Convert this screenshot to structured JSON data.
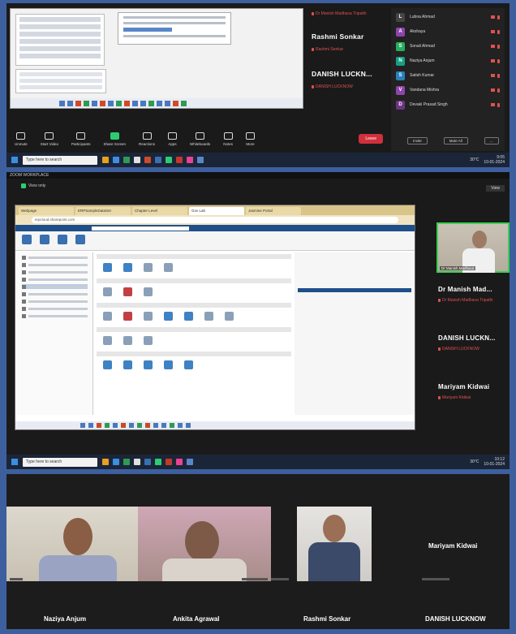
{
  "panel1": {
    "tile_names": [
      {
        "big": "",
        "small": "Dr Manish Madhava Tripathi"
      },
      {
        "big": "Rashmi Sonkar",
        "small": "Rashmi Sonkar"
      },
      {
        "big": "DANISH LUCKN...",
        "small": "DANISH LUCKNOW"
      }
    ],
    "participants": [
      {
        "name": "Lubna Ahmad",
        "initial": "L",
        "color": "#444444"
      },
      {
        "name": "Akshaya",
        "initial": "A",
        "color": "#8e44ad"
      },
      {
        "name": "Sonali Ahmad",
        "initial": "S",
        "color": "#27ae60"
      },
      {
        "name": "Naziya Anjum",
        "initial": "N",
        "color": "#16a085"
      },
      {
        "name": "Satish Kumar",
        "initial": "S",
        "color": "#2980b9"
      },
      {
        "name": "Vandana Mishra",
        "initial": "V",
        "color": "#8e44ad"
      },
      {
        "name": "Devaki Prasad Singh",
        "initial": "D",
        "color": "#6c3483"
      }
    ],
    "panel_buttons": [
      "Invite",
      "Mute All",
      "..."
    ],
    "toolbar": [
      {
        "label": "Unmute",
        "icon": "mic-icon",
        "green": false
      },
      {
        "label": "Start Video",
        "icon": "video-icon",
        "green": false
      },
      {
        "label": "Participants",
        "icon": "participants-icon",
        "green": false
      },
      {
        "label": "Share Screen",
        "icon": "share-screen-icon",
        "green": true
      },
      {
        "label": "Reactions",
        "icon": "reactions-icon",
        "green": false
      },
      {
        "label": "Apps",
        "icon": "apps-icon",
        "green": false
      },
      {
        "label": "Whiteboards",
        "icon": "whiteboard-icon",
        "green": false
      },
      {
        "label": "Notes",
        "icon": "notes-icon",
        "green": false
      },
      {
        "label": "More",
        "icon": "more-icon",
        "green": false
      }
    ],
    "leave_label": "Leave",
    "taskbar": {
      "search_placeholder": "Type here to search",
      "weather": "30°C",
      "time": "9:05",
      "date": "10-01-2024"
    }
  },
  "panel2": {
    "title": "ZOOM WORKPLACE",
    "view_label": "View only",
    "view_button": "View",
    "browser_tabs": [
      "Webpage",
      "ERPSampleDataSet",
      "Chapter Level",
      "Gov Lab",
      "Jasmine Portal"
    ],
    "address": "erpcloud.sharepoint.com",
    "camera_tile": "Dr Manish Madhava",
    "names": [
      {
        "big": "Dr Manish Mad...",
        "small": "Dr Manish Madhava Tripathi"
      },
      {
        "big": "DANISH LUCKN...",
        "small": "DANISH LUCKNOW"
      },
      {
        "big": "Mariyam Kidwai",
        "small": "Mariyam Kidwai"
      }
    ],
    "taskbar": {
      "search_placeholder": "Type here to search",
      "weather": "30°C",
      "time": "10:12",
      "date": "10-01-2024"
    }
  },
  "panel3": {
    "top_name": "Mariyam Kidwai",
    "labels": [
      "Naziya Anjum",
      "Ankita Agrawal",
      "Rashmi Sonkar",
      "DANISH LUCKNOW"
    ]
  }
}
